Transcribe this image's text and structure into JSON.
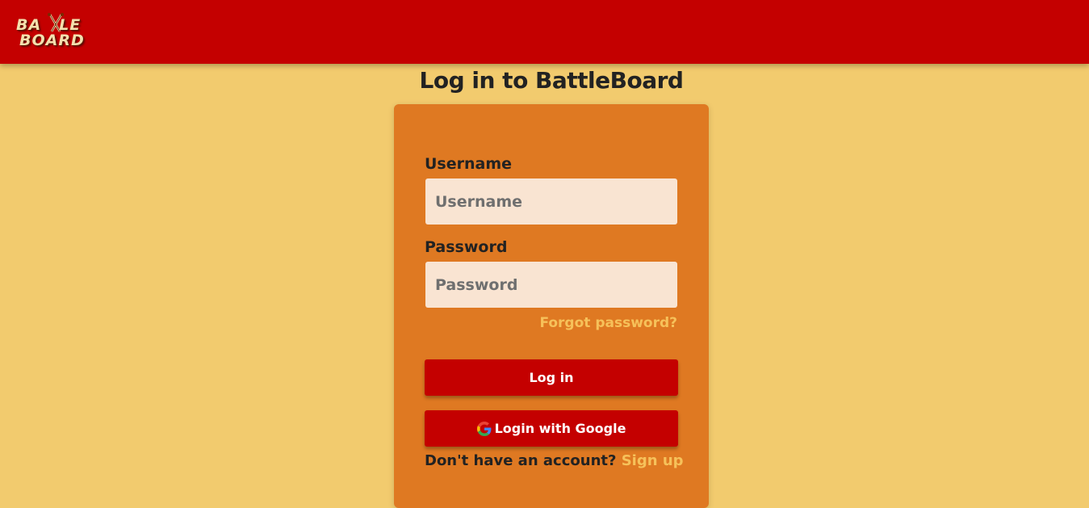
{
  "navbar": {
    "logo_line1": "BATTLE",
    "logo_line2": "BOARD",
    "background": "#c40000"
  },
  "page": {
    "title": "Log in to BattleBoard",
    "background": "#f2cb6e"
  },
  "form": {
    "background": "#df7922",
    "username_label": "Username",
    "username_placeholder": "Username",
    "username_value": "",
    "password_label": "Password",
    "password_placeholder": "Password",
    "password_value": "",
    "forgot_link": "Forgot password?",
    "login_button": "Log in",
    "google_button": "Login with Google",
    "google_icon": "google-icon",
    "signup_prompt": "Don't have an account?",
    "signup_link": "Sign up",
    "link_color": "#f6c15a",
    "button_color": "#c40000"
  }
}
